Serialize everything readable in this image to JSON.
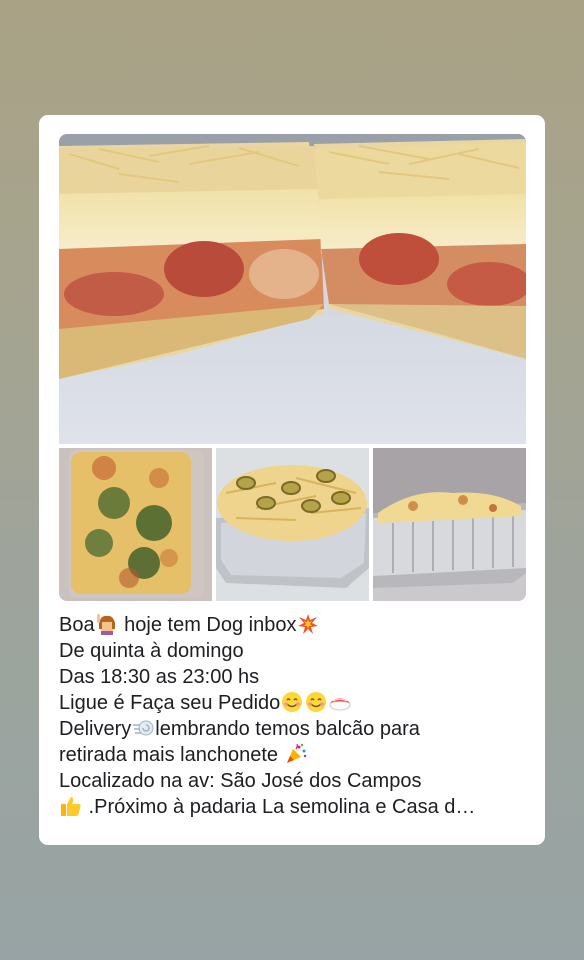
{
  "post": {
    "caption_lines": [
      {
        "before": "Boa",
        "after": " hoje tem Dog inbox"
      },
      {
        "text": "De quinta à domingo"
      },
      {
        "text": "Das 18:30 as 23:00 hs"
      },
      {
        "text": "Ligue é Faça seu Pedido"
      },
      {
        "before": "Delivery",
        "after": "lembrando temos balcão para"
      },
      {
        "text": "retirada mais lanchonete "
      },
      {
        "text": "Localizado na av: São José dos Campos"
      },
      {
        "text": " .Próximo à padaria La semolina e Casa d…"
      }
    ],
    "emoji_icons": [
      "woman-raising-hand-icon",
      "collision-icon",
      "smiling-face-icon",
      "smiling-face-icon",
      "sushi-icon",
      "dash-icon",
      "party-popper-icon",
      "thumbs-up-icon"
    ],
    "photos": {
      "main": "hot-dog-lasagna-slice-photo",
      "thumbnails": [
        "broccoli-gratin-photo",
        "olive-potato-straw-photo",
        "cheese-lasagna-tray-photo"
      ]
    }
  }
}
